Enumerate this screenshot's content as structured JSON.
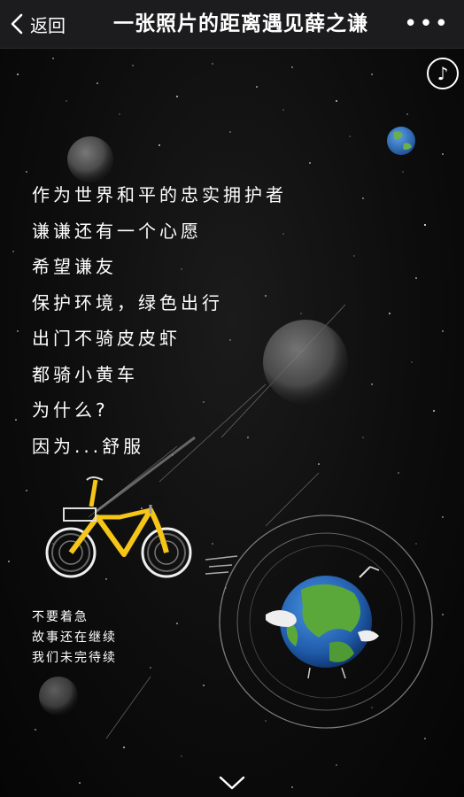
{
  "nav": {
    "back_label": "返回",
    "title": "一张照片的距离遇见薛之谦",
    "more_label": "•••"
  },
  "music_icon": "music-note-icon",
  "poem": {
    "lines": [
      "作为世界和平的忠实拥护者",
      "谦谦还有一个心愿",
      "希望谦友",
      "保护环境，绿色出行",
      "出门不骑皮皮虾",
      "都骑小黄车",
      "为什么?",
      "因为...舒服"
    ]
  },
  "subtext": {
    "lines": [
      "不要着急",
      "故事还在继续",
      "我们未完待续"
    ]
  },
  "icons": {
    "bike": "yellow-bicycle-icon",
    "earth": "earth-globe-icon",
    "scroll": "chevron-down-icon"
  },
  "colors": {
    "bike": "#f5c518",
    "ocean": "#2c6fc4",
    "land": "#5aa83a",
    "background": "#0a0a0a"
  }
}
